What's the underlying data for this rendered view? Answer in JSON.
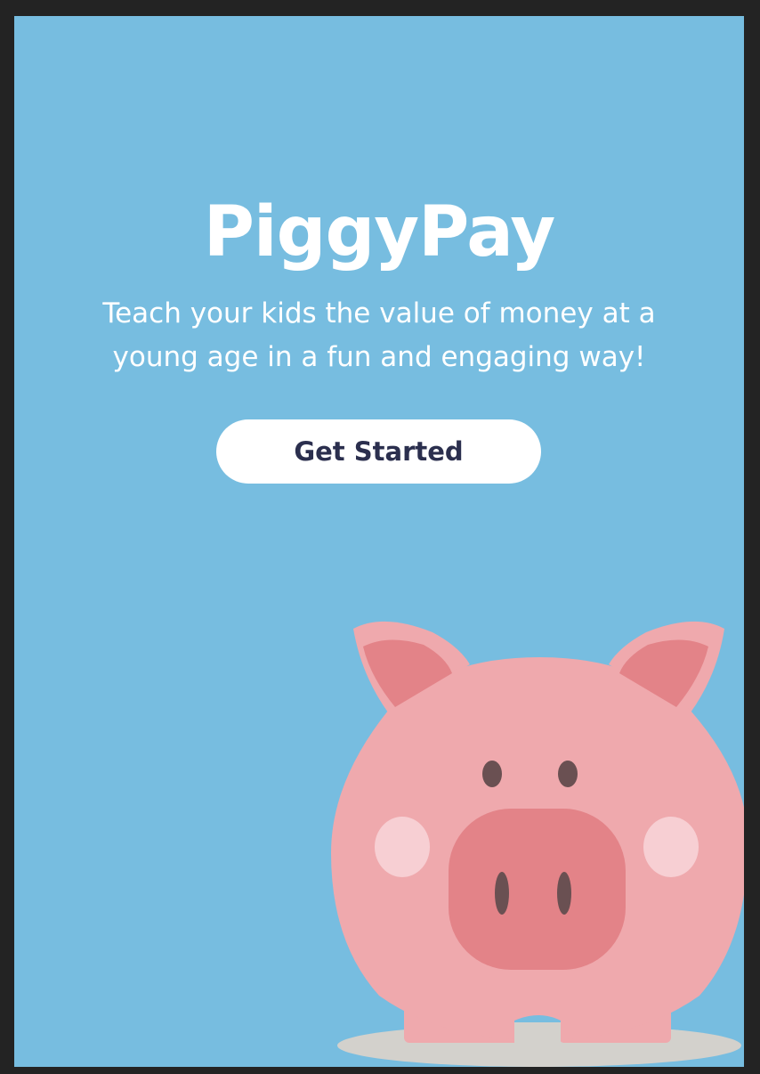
{
  "hero": {
    "title": "PiggyPay",
    "subtitle": "Teach your kids the value of money at a young age in a fun and engaging way!",
    "cta_label": "Get Started"
  },
  "colors": {
    "background": "#77bde0",
    "frame": "#232323",
    "button_bg": "#ffffff",
    "button_text": "#2b2f4e",
    "pig_body": "#efa9ad",
    "pig_snout": "#e38388",
    "pig_cheeks": "#f7cfd3",
    "pig_features": "#6a5052",
    "floor_shadow": "#d3d1cc"
  },
  "illustration": {
    "icon": "piggy-bank-icon"
  }
}
